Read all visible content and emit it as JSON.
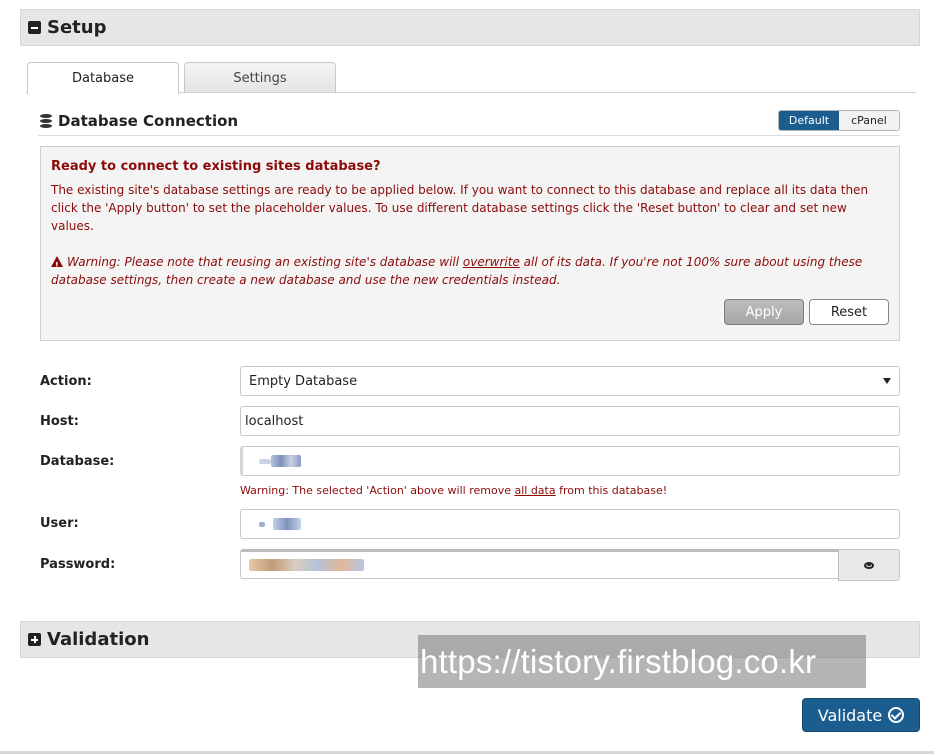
{
  "setup": {
    "title": "Setup"
  },
  "tabs": [
    {
      "label": "Database",
      "active": true
    },
    {
      "label": "Settings",
      "active": false
    }
  ],
  "db_connection": {
    "title": "Database Connection",
    "mode_options": [
      "Default",
      "cPanel"
    ],
    "selected_mode": "Default"
  },
  "notice": {
    "title": "Ready to connect to existing sites database?",
    "body": "The existing site's database settings are ready to be applied below. If you want to connect to this database and replace all its data then click the 'Apply button' to set the placeholder values. To use different database settings click the 'Reset button' to clear and set new values.",
    "warning_prefix": "Warning: Please note that reusing an existing site's database will ",
    "warning_link": "overwrite",
    "warning_suffix": " all of its data. If you're not 100% sure about using these database settings, then create a new database and use the new credentials instead.",
    "apply_label": "Apply",
    "reset_label": "Reset"
  },
  "form": {
    "action_label": "Action:",
    "action_value": "Empty Database",
    "host_label": "Host:",
    "host_value": "localhost",
    "database_label": "Database:",
    "user_label": "User:",
    "password_label": "Password:",
    "db_warning_prefix": "Warning: The selected 'Action' above will remove ",
    "db_warning_link": "all data",
    "db_warning_suffix": " from this database!"
  },
  "validation": {
    "title": "Validation"
  },
  "watermark": "https://tistory.firstblog.co.kr",
  "validate_button": {
    "label": "Validate"
  },
  "colors": {
    "accent": "#1c5d8f",
    "warning_text": "#8b0b0b",
    "section_bg": "#e6e6e6"
  }
}
